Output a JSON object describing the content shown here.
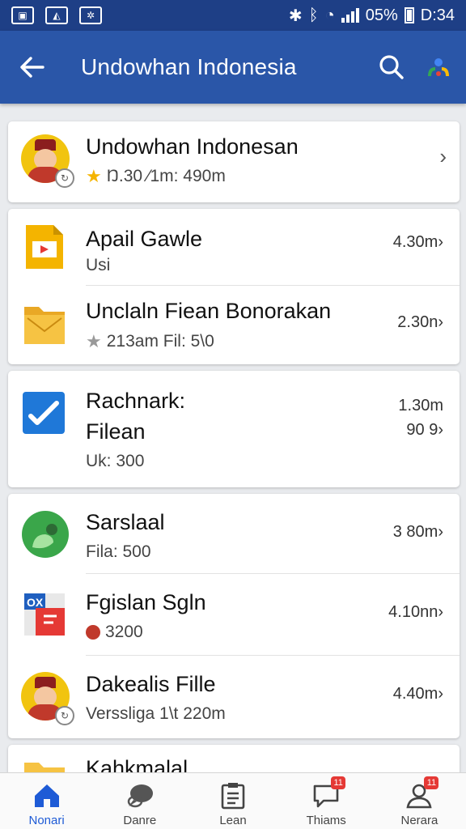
{
  "status_bar": {
    "battery": "05%",
    "time": "D:34"
  },
  "app_bar": {
    "title": "Undowhan Indonesia"
  },
  "header_card": {
    "title": "Undowhan Indonesan",
    "subtitle": "Ŋ.30 ⁄1m: 490m"
  },
  "groups": [
    {
      "items": [
        {
          "title": "Apail Gawle",
          "subtitle": "Usi",
          "meta": "4.30m›",
          "icon": "slides-icon"
        },
        {
          "title": "Unclaln Fiean Bonorakan",
          "subtitle": "213am Fil: 5\\0",
          "meta": "2.30n›",
          "icon": "folder-mail-icon",
          "star": true
        }
      ]
    },
    {
      "items": [
        {
          "title_line1": "Rachnark:",
          "title_line2": "Filean",
          "subtitle": "Uk: 300",
          "meta_line1": "1.30m",
          "meta_line2": "90 9›",
          "icon": "checkmark-app-icon"
        }
      ]
    },
    {
      "items": [
        {
          "title": "Sarslaal",
          "subtitle": "Fila: 500",
          "meta": "3 80m›",
          "icon": "chat-bubble-icon"
        },
        {
          "title": "Fgislan Sgln",
          "subtitle": "3200",
          "meta": "4.10nn›",
          "icon": "office-doc-icon",
          "pin": true
        },
        {
          "title": "Dakealis Fille",
          "subtitle": "Verssliga 1\\t 220m",
          "meta": "4.40m›",
          "icon": "avatar"
        }
      ]
    },
    {
      "items": [
        {
          "title": "Kahkmalal",
          "icon": "folder-icon"
        }
      ]
    }
  ],
  "bottom_nav": [
    {
      "label": "Nonari",
      "icon": "home-icon",
      "active": true
    },
    {
      "label": "Danre",
      "icon": "chat-icon"
    },
    {
      "label": "Lean",
      "icon": "clipboard-icon"
    },
    {
      "label": "Thiams",
      "icon": "message-icon",
      "badge": "11"
    },
    {
      "label": "Nerara",
      "icon": "person-icon",
      "badge": "11"
    }
  ],
  "colors": {
    "status_bar": "#1e3f86",
    "app_bar": "#2a56a8",
    "accent": "#1e5bd6",
    "badge": "#e53935"
  }
}
